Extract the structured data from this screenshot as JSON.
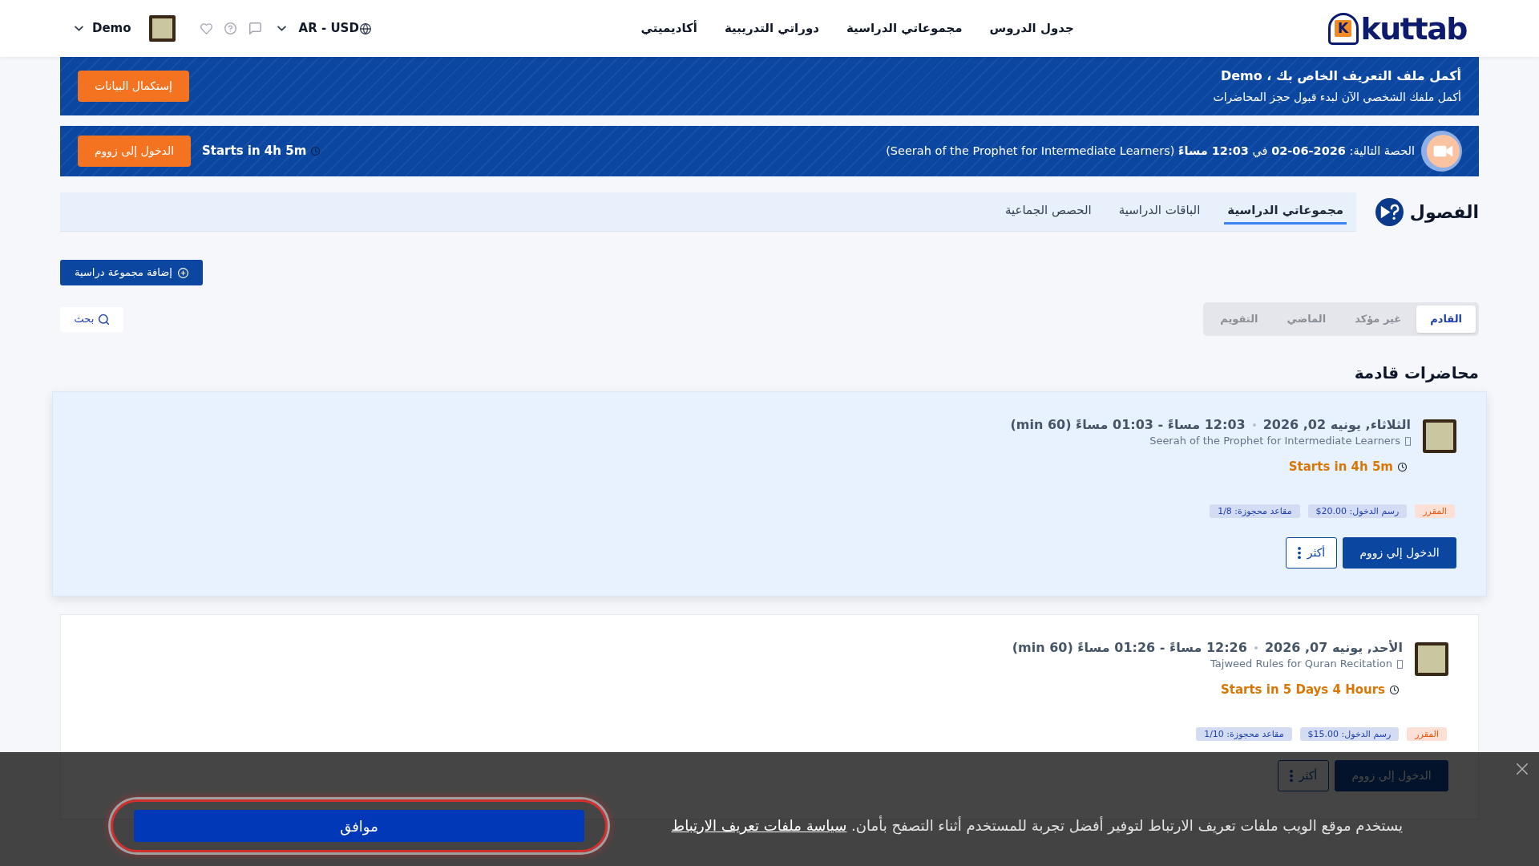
{
  "header": {
    "logo": {
      "mark": "K",
      "text": "kuttab"
    },
    "nav": [
      {
        "label": "جدول الدروس"
      },
      {
        "label": "مجموعاتي الدراسية"
      },
      {
        "label": "دوراتي التدريبية"
      },
      {
        "label": "أكاديميتي"
      }
    ],
    "locale": "AR - USD",
    "user": "Demo"
  },
  "profile_banner": {
    "title": "أكمل ملف التعريف الخاص بك ، Demo",
    "subtitle": "أكمل ملفك الشخصي الآن لبدء قبول حجز المحاضرات",
    "button": "إستكمال البيانات"
  },
  "next_session_banner": {
    "text": "الحصة التالية: **2026-06-02** في **12:03 مساءً** (Seerah of the Prophet for Intermediate Learners)",
    "countdown": "Starts in 4h 5m",
    "button": "الدخول إلى زووم"
  },
  "section": {
    "title": "الفصول",
    "tabs": [
      {
        "label": "مجموعاتي الدراسية",
        "selected": true
      },
      {
        "label": "الباقات الدراسية",
        "selected": false
      },
      {
        "label": "الحصص الجماعية",
        "selected": false
      }
    ]
  },
  "add_button": "إضافة مجموعة دراسية",
  "filters": [
    {
      "label": "القادم",
      "selected": true
    },
    {
      "label": "غير مؤكد",
      "selected": false
    },
    {
      "label": "الماضي",
      "selected": false
    },
    {
      "label": "التقويم",
      "selected": false
    }
  ],
  "search_button": "بحث",
  "list_title": "محاضرات قادمة",
  "sessions": [
    {
      "highlighted": true,
      "date": "الثلاثاء, يونيه 02, 2026",
      "time": "12:03 مساءً - 01:03 مساءً (60 min)",
      "course": "Seerah of the Prophet for Intermediate Learners",
      "countdown": "Starts in 4h 5m",
      "tags": [
        {
          "kind": "course",
          "label": "المقرر"
        },
        {
          "kind": "info",
          "label": "رسم الدخول: 20.00$"
        },
        {
          "kind": "info",
          "label": "مقاعد محجوزة: 1/8"
        }
      ],
      "join_button": "الدخول إلي زووم",
      "more_button": "أكثر"
    },
    {
      "highlighted": false,
      "date": "الأحد, يونيه 07, 2026",
      "time": "12:26 مساءً - 01:26 مساءً (60 min)",
      "course": "Tajweed Rules for Quran Recitation",
      "countdown": "Starts in 5 Days 4 Hours",
      "tags": [
        {
          "kind": "course",
          "label": "المقرر"
        },
        {
          "kind": "info",
          "label": "رسم الدخول: 15.00$"
        },
        {
          "kind": "info",
          "label": "مقاعد محجوزة: 1/10"
        }
      ],
      "join_button": "الدخول إلي زووم",
      "more_button": "أكثر"
    }
  ],
  "cookie_bar": {
    "text": "يستخدم موقع الويب ملفات تعريف الارتباط لتوفير أفضل تجربة للمستخدم أثناء التصفح بأمان.",
    "link": "سياسة ملفات تعريف الارتباط",
    "button": "موافق"
  }
}
